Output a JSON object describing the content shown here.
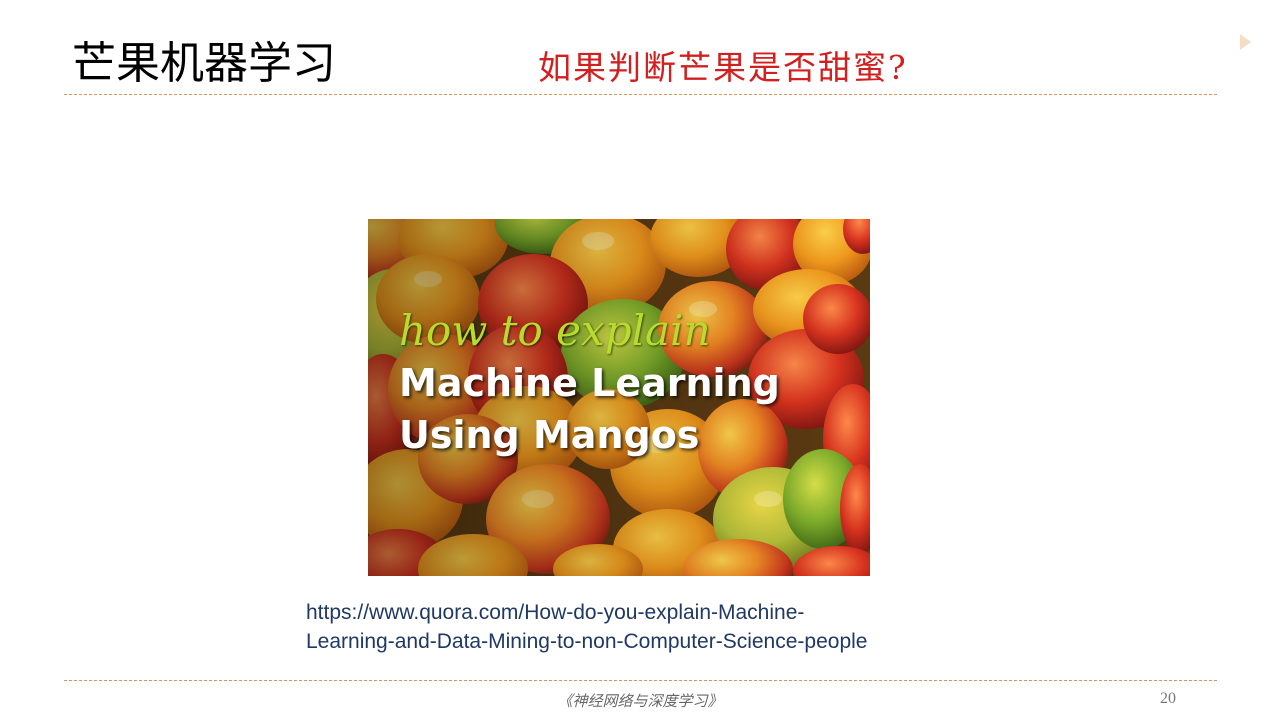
{
  "slide": {
    "title": "芒果机器学习",
    "subtitle": "如果判断芒果是否甜蜜?",
    "image": {
      "line1": "how to explain",
      "line2": "Machine Learning",
      "line3": "Using Mangos"
    },
    "source_url_line1": "https://www.quora.com/How-do-you-explain-Machine-",
    "source_url_line2": "Learning-and-Data-Mining-to-non-Computer-Science-people",
    "footer": "《神经网络与深度学习》",
    "page_number": "20"
  },
  "icons": {
    "nav": "next-slide-arrow-icon"
  },
  "colors": {
    "title": "#000000",
    "subtitle": "#d21f1f",
    "rule": "#d9955a",
    "source_link": "#1f3864",
    "image_script_text": "#b8dc2a",
    "image_bold_text": "#ffffff"
  }
}
